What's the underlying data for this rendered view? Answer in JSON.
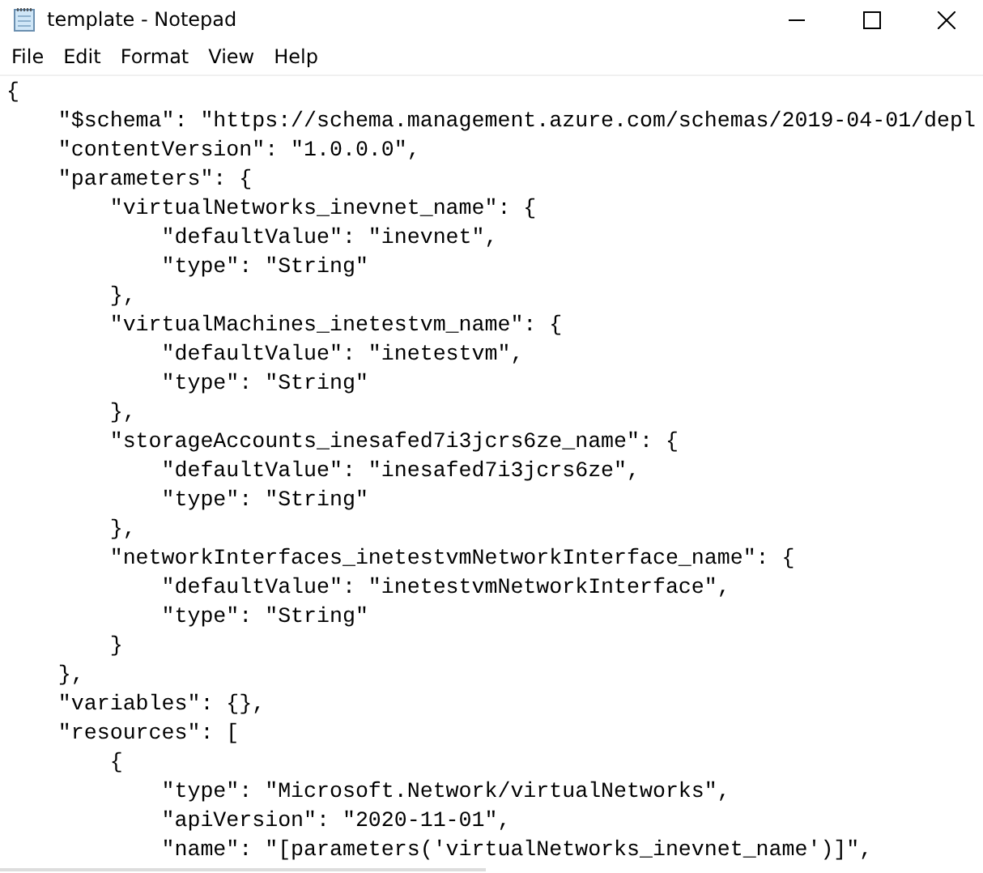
{
  "window": {
    "title": "template - Notepad"
  },
  "menu": [
    "File",
    "Edit",
    "Format",
    "View",
    "Help"
  ],
  "editor": {
    "lines": [
      "{",
      "    \"$schema\": \"https://schema.management.azure.com/schemas/2019-04-01/depl",
      "    \"contentVersion\": \"1.0.0.0\",",
      "    \"parameters\": {",
      "        \"virtualNetworks_inevnet_name\": {",
      "            \"defaultValue\": \"inevnet\",",
      "            \"type\": \"String\"",
      "        },",
      "        \"virtualMachines_inetestvm_name\": {",
      "            \"defaultValue\": \"inetestvm\",",
      "            \"type\": \"String\"",
      "        },",
      "        \"storageAccounts_inesafed7i3jcrs6ze_name\": {",
      "            \"defaultValue\": \"inesafed7i3jcrs6ze\",",
      "            \"type\": \"String\"",
      "        },",
      "        \"networkInterfaces_inetestvmNetworkInterface_name\": {",
      "            \"defaultValue\": \"inetestvmNetworkInterface\",",
      "            \"type\": \"String\"",
      "        }",
      "    },",
      "    \"variables\": {},",
      "    \"resources\": [",
      "        {",
      "            \"type\": \"Microsoft.Network/virtualNetworks\",",
      "            \"apiVersion\": \"2020-11-01\",",
      "            \"name\": \"[parameters('virtualNetworks_inevnet_name')]\","
    ]
  }
}
